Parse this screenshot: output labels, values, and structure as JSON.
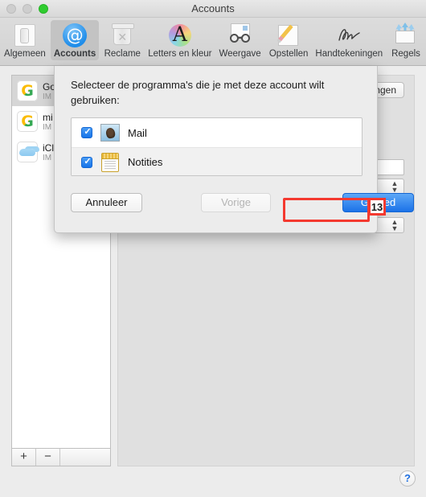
{
  "window": {
    "title": "Accounts",
    "traffic_lights": [
      "close",
      "minimize",
      "zoom"
    ]
  },
  "toolbar": {
    "items": [
      {
        "label": "Algemeen",
        "icon": "general-icon",
        "selected": false
      },
      {
        "label": "Accounts",
        "icon": "at-sign-icon",
        "selected": true
      },
      {
        "label": "Reclame",
        "icon": "trash-icon",
        "selected": false
      },
      {
        "label": "Letters en kleur",
        "icon": "font-color-icon",
        "selected": false
      },
      {
        "label": "Weergave",
        "icon": "glasses-icon",
        "selected": false
      },
      {
        "label": "Opstellen",
        "icon": "pencil-note-icon",
        "selected": false
      },
      {
        "label": "Handtekeningen",
        "icon": "signature-icon",
        "selected": false
      },
      {
        "label": "Regels",
        "icon": "envelope-arrows-icon",
        "selected": false
      }
    ]
  },
  "accounts_sidebar": {
    "rows": [
      {
        "name": "Go",
        "sub": "IM",
        "icon": "google-icon",
        "selected": true
      },
      {
        "name": "mi",
        "sub": "IM",
        "icon": "google-icon",
        "selected": false
      },
      {
        "name": "iCl",
        "sub": "IM",
        "icon": "icloud-icon",
        "selected": false
      }
    ],
    "add_label": "+",
    "remove_label": "−"
  },
  "detail_panel": {
    "tab_label": "ingen",
    "stepper_glyph": "⌃⌄"
  },
  "sheet": {
    "prompt": "Selecteer de programma's die je met deze account wilt gebruiken:",
    "apps": [
      {
        "label": "Mail",
        "checked": true,
        "icon": "mail-app-icon"
      },
      {
        "label": "Notities",
        "checked": true,
        "icon": "notes-app-icon"
      }
    ],
    "buttons": {
      "cancel": "Annuleer",
      "back": "Vorige",
      "done": "Gereed"
    }
  },
  "annotation": {
    "step_number": "13",
    "highlight_color": "#f4392f"
  },
  "help": {
    "label": "?"
  }
}
